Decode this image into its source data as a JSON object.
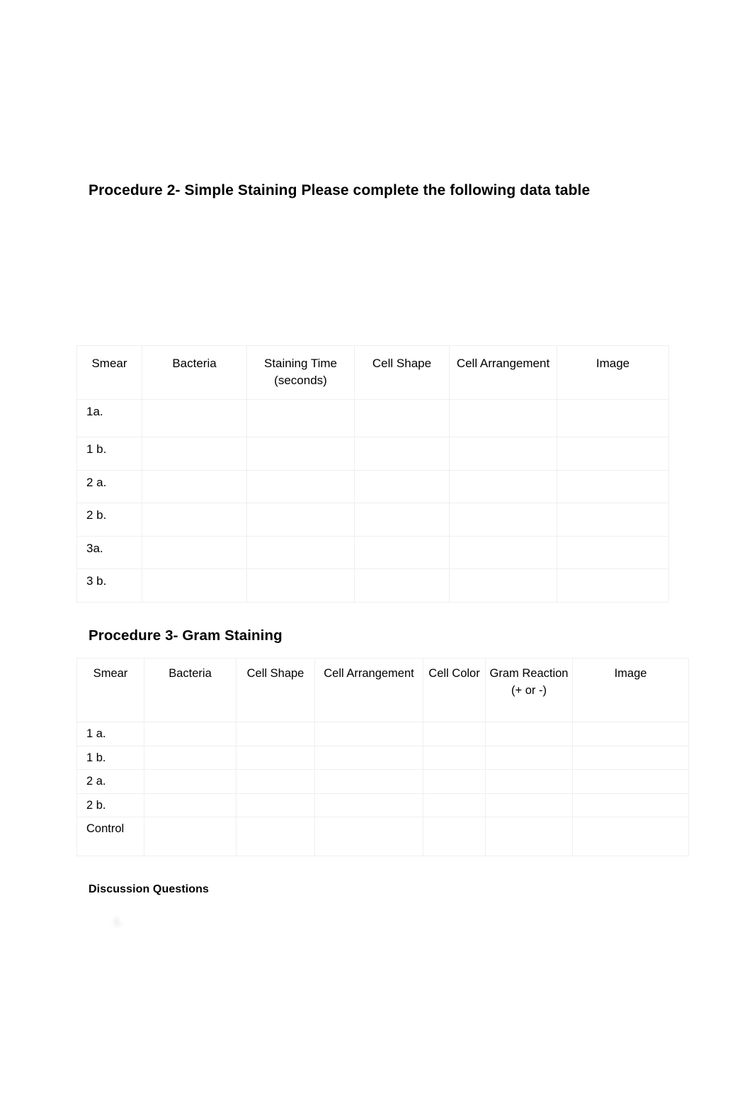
{
  "document": {
    "procedure2": {
      "heading": "Procedure 2- Simple Staining Please complete the following data table",
      "table": {
        "columns": [
          "Smear",
          "Bacteria",
          "Staining Time (seconds)",
          "Cell Shape",
          "Cell Arrangement",
          "Image"
        ],
        "rows": [
          {
            "smear": "1a.",
            "bacteria": "",
            "staining_time": "",
            "cell_shape": "",
            "cell_arrangement": "",
            "image": ""
          },
          {
            "smear": "1 b.",
            "bacteria": "",
            "staining_time": "",
            "cell_shape": "",
            "cell_arrangement": "",
            "image": ""
          },
          {
            "smear": "2 a.",
            "bacteria": "",
            "staining_time": "",
            "cell_shape": "",
            "cell_arrangement": "",
            "image": ""
          },
          {
            "smear": "2 b.",
            "bacteria": "",
            "staining_time": "",
            "cell_shape": "",
            "cell_arrangement": "",
            "image": ""
          },
          {
            "smear": "3a.",
            "bacteria": "",
            "staining_time": "",
            "cell_shape": "",
            "cell_arrangement": "",
            "image": ""
          },
          {
            "smear": "3 b.",
            "bacteria": "",
            "staining_time": "",
            "cell_shape": "",
            "cell_arrangement": "",
            "image": ""
          }
        ]
      }
    },
    "procedure3": {
      "heading": "Procedure 3- Gram Staining",
      "table": {
        "columns": [
          "Smear",
          "Bacteria",
          "Cell Shape",
          "Cell Arrangement",
          "Cell Color",
          "Gram Reaction (+ or -)",
          "Image"
        ],
        "rows": [
          {
            "smear": "1 a.",
            "bacteria": "",
            "cell_shape": "",
            "cell_arrangement": "",
            "cell_color": "",
            "gram_reaction": "",
            "image": ""
          },
          {
            "smear": "1 b.",
            "bacteria": "",
            "cell_shape": "",
            "cell_arrangement": "",
            "cell_color": "",
            "gram_reaction": "",
            "image": ""
          },
          {
            "smear": "2 a.",
            "bacteria": "",
            "cell_shape": "",
            "cell_arrangement": "",
            "cell_color": "",
            "gram_reaction": "",
            "image": ""
          },
          {
            "smear": "2 b.",
            "bacteria": "",
            "cell_shape": "",
            "cell_arrangement": "",
            "cell_color": "",
            "gram_reaction": "",
            "image": ""
          },
          {
            "smear": "Control",
            "bacteria": "",
            "cell_shape": "",
            "cell_arrangement": "",
            "cell_color": "",
            "gram_reaction": "",
            "image": ""
          }
        ]
      }
    },
    "discussion": {
      "heading": "Discussion Questions",
      "questions": [
        {
          "marker": "1.",
          "text": ""
        }
      ]
    }
  }
}
